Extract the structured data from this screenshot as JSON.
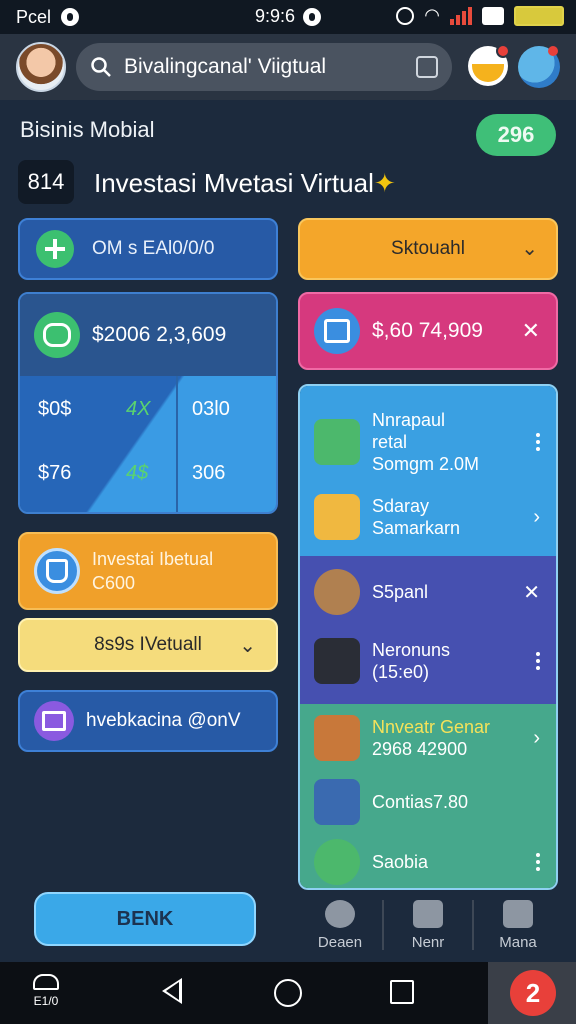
{
  "statusbar": {
    "carrier": "Pcel",
    "time": "9:9:6"
  },
  "header": {
    "search_text": "Bivalingcanal' Viigtual"
  },
  "subtitle": "Bisinis Mobial",
  "count_pill": "296",
  "num_box": "814",
  "main_title": "Investasi Mvetasi Virtual",
  "left": {
    "card1_label": "OM s EAl0/0/0",
    "big_amount": "$2006 2,3,609",
    "grid": {
      "r1c1": "$0$",
      "r1c2": "4X",
      "r1c3": "03l0",
      "r2c1": "$76",
      "r2c2": "4$",
      "r2c3": "306"
    },
    "orange_line1": "Investai Ibetual",
    "orange_line2": "C600",
    "yellow_label": "8s9s IVetuall",
    "blue2_label": "hvebkacina @onV"
  },
  "right": {
    "orange_label": "Sktouahl",
    "pink_amount": "$,60 74,909",
    "list": [
      {
        "line1": "Nnrapaul",
        "line2": "retal",
        "line3": "Somgm 2.0M"
      },
      {
        "line1": "Sdaray",
        "line2": "Samarkarn"
      },
      {
        "line1": "S5panl"
      },
      {
        "line1": "Neronuns",
        "line2": "(15:e0)"
      },
      {
        "line1": "Nnveatr Genar",
        "line2": "2968 42900"
      },
      {
        "line1": "Contias7.80"
      },
      {
        "line1": "Saobia"
      }
    ]
  },
  "bottom": {
    "benk": "BENK",
    "tab1": "Deaen",
    "tab2": "Nenr",
    "tab3": "Mana"
  },
  "navbar": {
    "cloud_label": "E1/0",
    "extra": "2"
  },
  "colors": {
    "accent_green": "#3fbf78",
    "accent_pink": "#d6397e",
    "accent_orange": "#f4a62a",
    "bg": "#1c2a3d"
  }
}
